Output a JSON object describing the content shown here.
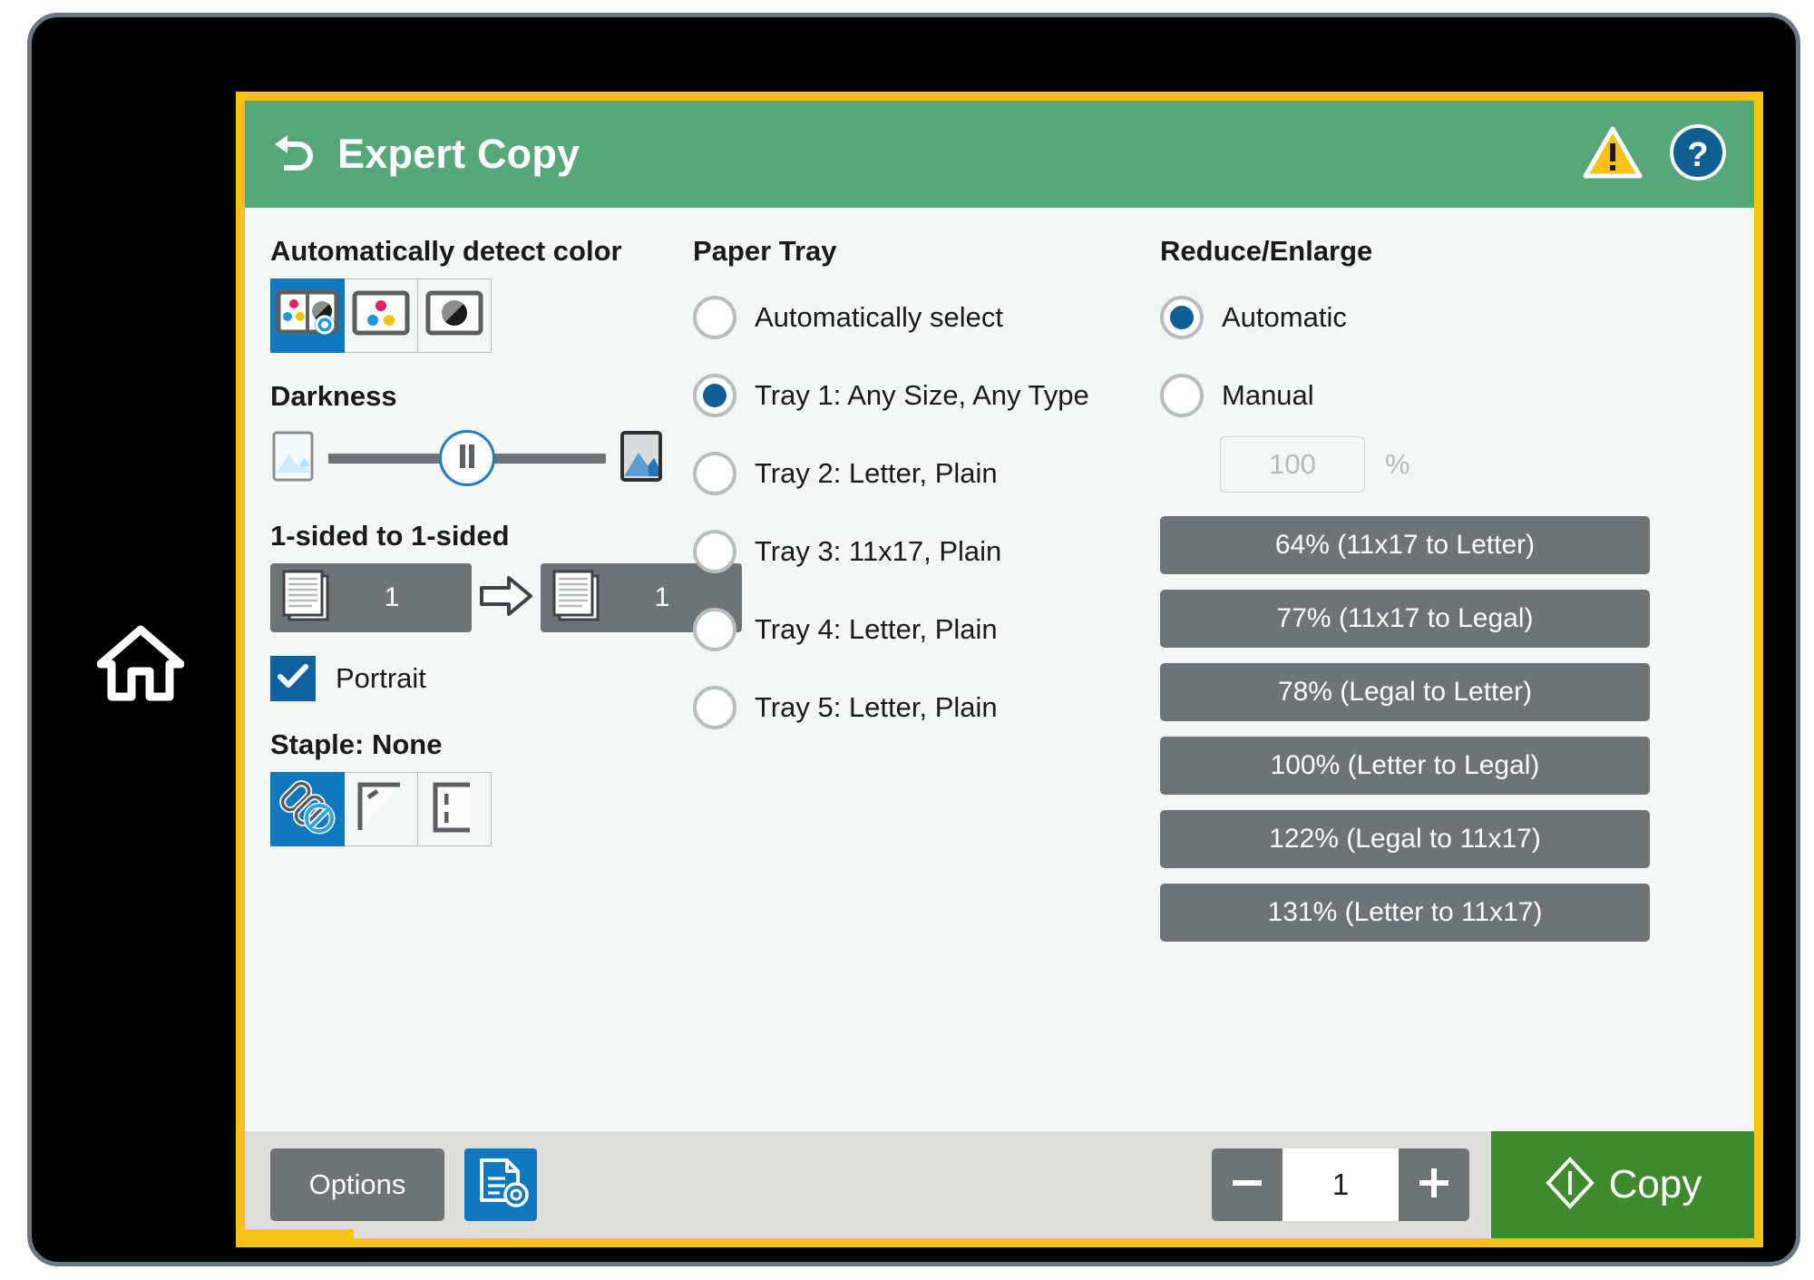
{
  "device": {
    "home_key_icon": "home-icon"
  },
  "header": {
    "back_icon": "back-arrow-icon",
    "title": "Expert Copy",
    "warning_icon": "warning-triangle-icon",
    "help_icon": "help-question-icon"
  },
  "color_mode": {
    "title": "Automatically detect color",
    "options": [
      {
        "name": "auto-detect-color",
        "icon": "auto-color-icon",
        "selected": true
      },
      {
        "name": "color",
        "icon": "color-icon",
        "selected": false
      },
      {
        "name": "black-and-white",
        "icon": "grayscale-icon",
        "selected": false
      }
    ]
  },
  "darkness": {
    "title": "Darkness",
    "light_icon": "image-light-icon",
    "dark_icon": "image-dark-icon",
    "thumb_icon": "pause-bars-icon",
    "value_percent": 50
  },
  "sides": {
    "title": "1-sided to 1-sided",
    "original": {
      "icon": "document-stack-icon",
      "count": "1"
    },
    "arrow_icon": "arrow-right-icon",
    "output": {
      "icon": "document-stack-icon",
      "count": "1"
    }
  },
  "orientation": {
    "checkbox_icon": "checkmark-icon",
    "label": "Portrait",
    "checked": true
  },
  "staple": {
    "title": "Staple: None",
    "options": [
      {
        "name": "staple-none",
        "icon": "staple-none-icon",
        "selected": true
      },
      {
        "name": "staple-corner",
        "icon": "staple-corner-icon",
        "selected": false
      },
      {
        "name": "staple-edge",
        "icon": "staple-edge-icon",
        "selected": false
      }
    ]
  },
  "paper_tray": {
    "title": "Paper Tray",
    "options": [
      {
        "label": "Automatically select",
        "selected": false
      },
      {
        "label": "Tray 1: Any Size, Any Type",
        "selected": true
      },
      {
        "label": "Tray 2: Letter, Plain",
        "selected": false
      },
      {
        "label": "Tray 3: 11x17, Plain",
        "selected": false
      },
      {
        "label": "Tray 4: Letter, Plain",
        "selected": false
      },
      {
        "label": "Tray 5: Letter, Plain",
        "selected": false
      }
    ]
  },
  "reduce_enlarge": {
    "title": "Reduce/Enlarge",
    "modes": [
      {
        "label": "Automatic",
        "selected": true
      },
      {
        "label": "Manual",
        "selected": false
      }
    ],
    "manual_placeholder": "100",
    "manual_unit": "%",
    "presets": [
      "64% (11x17 to Letter)",
      "77% (11x17 to Legal)",
      "78% (Legal to Letter)",
      "100% (Letter to Legal)",
      "122% (Legal to 11x17)",
      "131% (Letter to 11x17)"
    ]
  },
  "bottom_bar": {
    "options_label": "Options",
    "doc_settings_icon": "document-settings-icon",
    "minus_icon": "minus-icon",
    "plus_icon": "plus-icon",
    "copies": "1",
    "copy_icon": "start-diamond-icon",
    "copy_label": "Copy"
  },
  "colors": {
    "header_green": "#56a87b",
    "focus_yellow": "#f9c215",
    "accent_blue": "#0f79c0",
    "radio_blue": "#105f92",
    "copy_green": "#3f8a2e",
    "button_gray": "#6e7375",
    "panel_bg": "#f5f6f6",
    "bottom_bar_bg": "#dededd"
  }
}
